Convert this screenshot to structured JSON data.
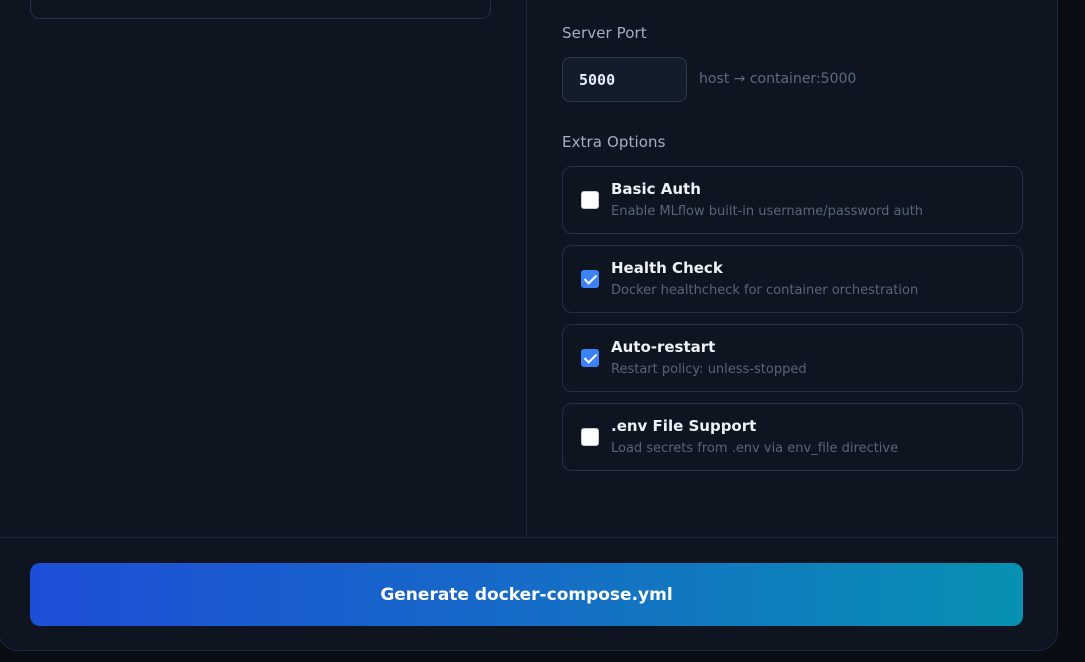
{
  "server_port": {
    "label": "Server Port",
    "value": "5000",
    "hint": "host → container:5000"
  },
  "extra_options": {
    "label": "Extra Options",
    "items": [
      {
        "title": "Basic Auth",
        "description": "Enable MLflow built-in username/password auth",
        "checked": false
      },
      {
        "title": "Health Check",
        "description": "Docker healthcheck for container orchestration",
        "checked": true
      },
      {
        "title": "Auto-restart",
        "description": "Restart policy: unless-stopped",
        "checked": true
      },
      {
        "title": ".env File Support",
        "description": "Load secrets from .env via env_file directive",
        "checked": false
      }
    ]
  },
  "actions": {
    "generate_label": "Generate docker-compose.yml"
  },
  "colors": {
    "background": "#0e1420",
    "accent": "#3b82f6",
    "button_gradient_start": "#1d4ed8",
    "button_gradient_end": "#0891b2"
  }
}
